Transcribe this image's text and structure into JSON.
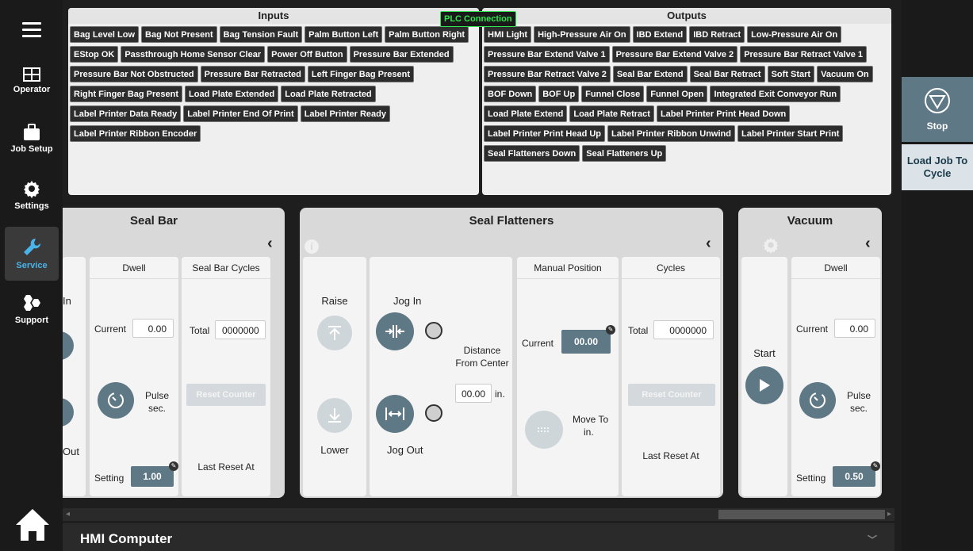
{
  "nav": {
    "items": [
      {
        "label": "Operator",
        "icon": "grid-icon"
      },
      {
        "label": "Job Setup",
        "icon": "briefcase-icon"
      },
      {
        "label": "Settings",
        "icon": "gear-icon"
      },
      {
        "label": "Service",
        "icon": "wrench-icon"
      },
      {
        "label": "Support",
        "icon": "hexagons-icon"
      }
    ],
    "active": "Service"
  },
  "plc": {
    "label": "PLC Connection",
    "color": "#2ee64d"
  },
  "inputs": {
    "title": "Inputs",
    "tags": [
      "Bag Level Low",
      "Bag Not Present",
      "Bag Tension Fault",
      "Palm Button Left",
      "Palm Button Right",
      "EStop OK",
      "Passthrough Home Sensor Clear",
      "Power Off Button",
      "Pressure Bar Extended",
      "Pressure Bar Not Obstructed",
      "Pressure Bar Retracted",
      "Left Finger Bag Present",
      "Right Finger Bag Present",
      "Load Plate Extended",
      "Load Plate Retracted",
      "Label Printer Data Ready",
      "Label Printer End Of Print",
      "Label Printer Ready",
      "Label Printer Ribbon Encoder"
    ]
  },
  "outputs": {
    "title": "Outputs",
    "tags": [
      "HMI Light",
      "High-Pressure Air On",
      "IBD Extend",
      "IBD Retract",
      "Low-Pressure Air On",
      "Pressure Bar Extend Valve 1",
      "Pressure Bar Extend Valve 2",
      "Pressure Bar Retract Valve 1",
      "Pressure Bar Retract Valve 2",
      "Seal Bar Extend",
      "Seal Bar Retract",
      "Soft Start",
      "Vacuum On",
      "BOF Down",
      "BOF Up",
      "Funnel Close",
      "Funnel Open",
      "Integrated Exit Conveyor Run",
      "Load Plate Extend",
      "Load Plate Retract",
      "Label Printer Print Head Down",
      "Label Printer Print Head Up",
      "Label Printer Ribbon Unwind",
      "Label Printer Start Print",
      "Seal Flatteners Down",
      "Seal Flatteners Up"
    ]
  },
  "right": {
    "stop_label": "Stop",
    "load_job_label": "Load Job To Cycle"
  },
  "seal_bar": {
    "title": "Seal Bar",
    "partial_in": "In",
    "partial_out": "Out",
    "dwell": {
      "header": "Dwell",
      "current_label": "Current",
      "current_value": "0.00",
      "pulse_label": "Pulse",
      "sec_label": "sec.",
      "setting_label": "Setting",
      "setting_value": "1.00"
    },
    "cycles": {
      "header": "Seal Bar Cycles",
      "total_label": "Total",
      "total_value": "0000000",
      "reset_label": "Reset Counter",
      "last_reset_label": "Last Reset At"
    }
  },
  "seal_flatteners": {
    "title": "Seal Flatteners",
    "raise_label": "Raise",
    "lower_label": "Lower",
    "jog_in_label": "Jog In",
    "jog_out_label": "Jog Out",
    "distance_label": "Distance From Center",
    "distance_value": "00.00",
    "distance_unit": "in.",
    "manual": {
      "header": "Manual Position",
      "current_label": "Current",
      "current_value": "00.00",
      "move_to_label": "Move To",
      "move_to_unit": "in."
    },
    "cycles": {
      "header": "Cycles",
      "total_label": "Total",
      "total_value": "0000000",
      "reset_label": "Reset Counter",
      "last_reset_label": "Last Reset At"
    }
  },
  "vacuum": {
    "title": "Vacuum",
    "start_label": "Start",
    "dwell": {
      "header": "Dwell",
      "current_label": "Current",
      "current_value": "0.00",
      "pulse_label": "Pulse",
      "sec_label": "sec.",
      "setting_label": "Setting",
      "setting_value": "0.50"
    }
  },
  "bottom": {
    "hmi_label": "HMI Computer"
  },
  "colors": {
    "accent": "#5f7886",
    "active_nav": "#4ab3e8"
  }
}
